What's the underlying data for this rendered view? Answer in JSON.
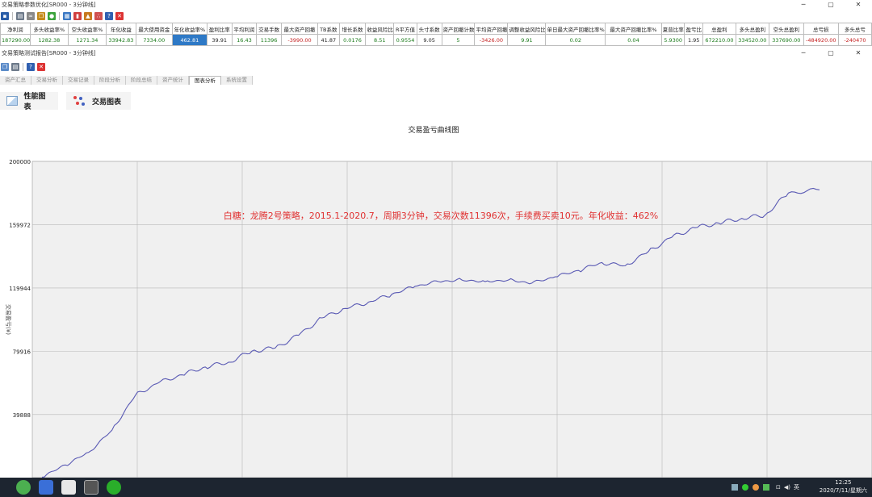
{
  "main_window": {
    "title": "交易策略参数优化[SR000 - 3分钟线]",
    "min": "─",
    "max": "▢",
    "close": "✕"
  },
  "stats_table": {
    "headers": [
      "净利润",
      "多头收益率%",
      "空头收益率%",
      "年化收益",
      "最大使用资金",
      "年化收益率%",
      "盈利比率",
      "平均利润",
      "交易手数",
      "最大资产回撤",
      "TB系数",
      "增长系数",
      "收益风险比",
      "R平方值",
      "头寸系数",
      "资产回撤计数",
      "平均资产回撤",
      "调整收益风险比",
      "单日最大资产回撤比率%",
      "最大资产回撤比率%",
      "夏普比率",
      "盈亏比",
      "总盈利",
      "多头总盈利",
      "空头总盈利",
      "总亏损",
      "多头总亏"
    ],
    "values": [
      "187290.00",
      "1282.38",
      "1271.34",
      "33942.83",
      "7334.00",
      "462.81",
      "39.91",
      "16.43",
      "11396",
      "-3990.00",
      "41.87",
      "0.0176",
      "8.51",
      "0.9554",
      "9.05",
      "5",
      "-3426.00",
      "9.91",
      "0.02",
      "0.04",
      "5.9300",
      "1.95",
      "672210.00",
      "334520.00",
      "337690.00",
      "-484920.00",
      "-240470"
    ]
  },
  "report_window": {
    "title": "交易策略测试报告[SR000 - 3分钟线]",
    "min": "─",
    "max": "▢",
    "close": "✕"
  },
  "tabs": [
    "资产汇总",
    "交易分析",
    "交易记录",
    "阶段分析",
    "阶段总结",
    "资产统计",
    "图表分析",
    "系统设置"
  ],
  "active_tab": "图表分析",
  "sub_buttons": {
    "performance": "性能图表",
    "trade": "交易图表"
  },
  "chart_data": {
    "type": "line",
    "title": "交易盈亏曲线图",
    "ylabel": "交易盈亏(¥)",
    "yticks": [
      39888,
      79916,
      119944,
      159972,
      200000
    ],
    "ylim": [
      0,
      200000
    ],
    "grid": true,
    "annotation": "白糖：龙腾2号策略，2015.1-2020.7，周期3分钟，交易次数11396次，手续费买卖10元。年化收益：462%",
    "line_color": "#5a5ab4",
    "annotation_color": "#e03030",
    "series": [
      {
        "x": [
          0,
          3,
          6,
          9,
          12,
          15,
          18,
          21,
          24,
          27,
          30,
          33,
          36,
          39,
          42,
          45,
          48,
          51,
          54,
          57,
          60,
          63,
          66,
          69,
          72,
          75,
          78,
          81,
          84,
          87,
          90,
          93,
          96,
          100
        ],
        "values": [
          300,
          8000,
          16000,
          30000,
          52000,
          60000,
          65000,
          70000,
          73000,
          80000,
          82000,
          90000,
          101000,
          107000,
          111000,
          116000,
          121000,
          124000,
          125000,
          124000,
          125000,
          123000,
          127000,
          131000,
          136000,
          134000,
          143000,
          152000,
          158000,
          161000,
          164000,
          166000,
          180000,
          182000
        ]
      }
    ]
  },
  "taskbar": {
    "tray_lang": "英",
    "time": "12:25",
    "date": "2020/7/11/星期六"
  }
}
